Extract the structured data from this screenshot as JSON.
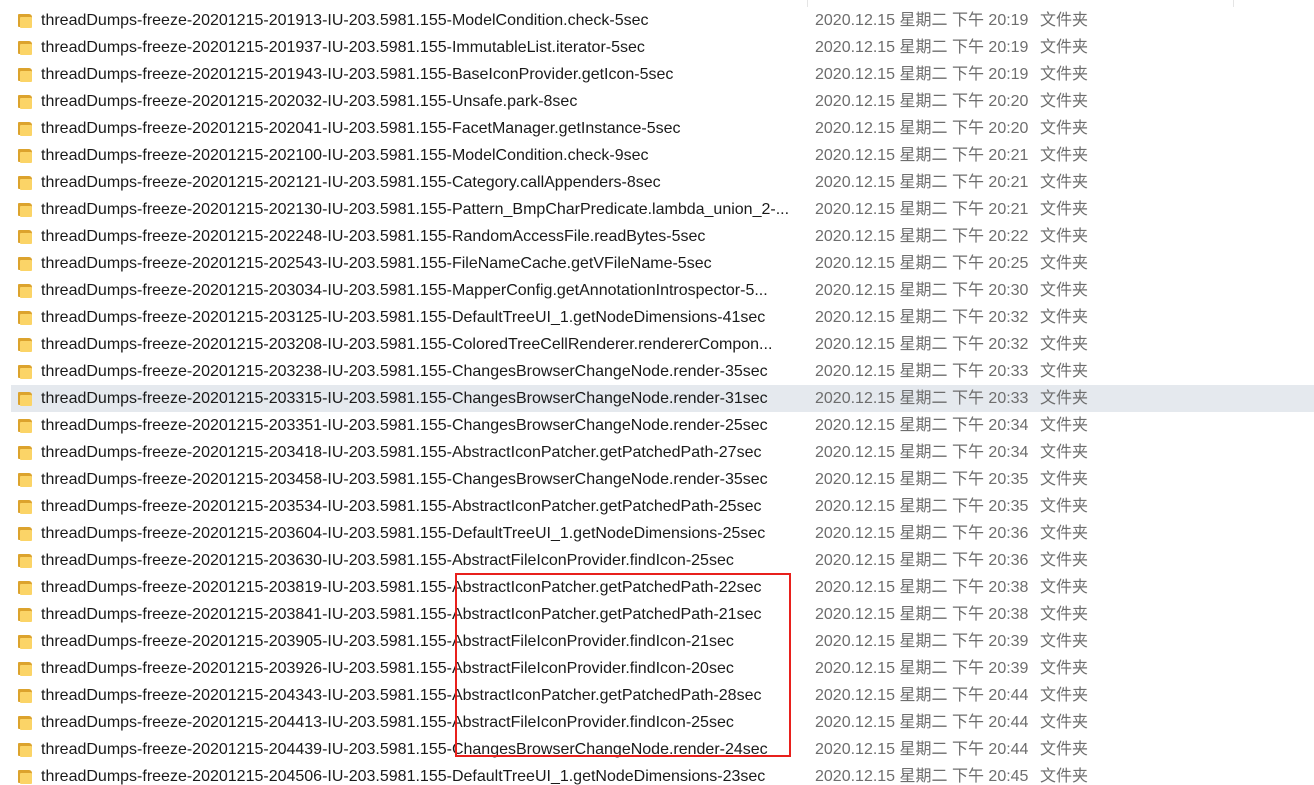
{
  "file_list": {
    "icon": "folder-icon",
    "highlight_color": "#e5e9ee",
    "annotation_color": "#e8201c",
    "rows": [
      {
        "name": "threadDumps-freeze-20201215-201913-IU-203.5981.155-ModelCondition.check-5sec",
        "date": "2020.12.15 星期二 下午 20:19",
        "type": "文件夹"
      },
      {
        "name": "threadDumps-freeze-20201215-201937-IU-203.5981.155-ImmutableList.iterator-5sec",
        "date": "2020.12.15 星期二 下午 20:19",
        "type": "文件夹"
      },
      {
        "name": "threadDumps-freeze-20201215-201943-IU-203.5981.155-BaseIconProvider.getIcon-5sec",
        "date": "2020.12.15 星期二 下午 20:19",
        "type": "文件夹"
      },
      {
        "name": "threadDumps-freeze-20201215-202032-IU-203.5981.155-Unsafe.park-8sec",
        "date": "2020.12.15 星期二 下午 20:20",
        "type": "文件夹"
      },
      {
        "name": "threadDumps-freeze-20201215-202041-IU-203.5981.155-FacetManager.getInstance-5sec",
        "date": "2020.12.15 星期二 下午 20:20",
        "type": "文件夹"
      },
      {
        "name": "threadDumps-freeze-20201215-202100-IU-203.5981.155-ModelCondition.check-9sec",
        "date": "2020.12.15 星期二 下午 20:21",
        "type": "文件夹"
      },
      {
        "name": "threadDumps-freeze-20201215-202121-IU-203.5981.155-Category.callAppenders-8sec",
        "date": "2020.12.15 星期二 下午 20:21",
        "type": "文件夹"
      },
      {
        "name": "threadDumps-freeze-20201215-202130-IU-203.5981.155-Pattern_BmpCharPredicate.lambda_union_2-...",
        "date": "2020.12.15 星期二 下午 20:21",
        "type": "文件夹"
      },
      {
        "name": "threadDumps-freeze-20201215-202248-IU-203.5981.155-RandomAccessFile.readBytes-5sec",
        "date": "2020.12.15 星期二 下午 20:22",
        "type": "文件夹"
      },
      {
        "name": "threadDumps-freeze-20201215-202543-IU-203.5981.155-FileNameCache.getVFileName-5sec",
        "date": "2020.12.15 星期二 下午 20:25",
        "type": "文件夹"
      },
      {
        "name": "threadDumps-freeze-20201215-203034-IU-203.5981.155-MapperConfig.getAnnotationIntrospector-5...",
        "date": "2020.12.15 星期二 下午 20:30",
        "type": "文件夹"
      },
      {
        "name": "threadDumps-freeze-20201215-203125-IU-203.5981.155-DefaultTreeUI_1.getNodeDimensions-41sec",
        "date": "2020.12.15 星期二 下午 20:32",
        "type": "文件夹"
      },
      {
        "name": "threadDumps-freeze-20201215-203208-IU-203.5981.155-ColoredTreeCellRenderer.rendererCompon...",
        "date": "2020.12.15 星期二 下午 20:32",
        "type": "文件夹"
      },
      {
        "name": "threadDumps-freeze-20201215-203238-IU-203.5981.155-ChangesBrowserChangeNode.render-35sec",
        "date": "2020.12.15 星期二 下午 20:33",
        "type": "文件夹"
      },
      {
        "name": "threadDumps-freeze-20201215-203315-IU-203.5981.155-ChangesBrowserChangeNode.render-31sec",
        "date": "2020.12.15 星期二 下午 20:33",
        "type": "文件夹",
        "hovered": true
      },
      {
        "name": "threadDumps-freeze-20201215-203351-IU-203.5981.155-ChangesBrowserChangeNode.render-25sec",
        "date": "2020.12.15 星期二 下午 20:34",
        "type": "文件夹"
      },
      {
        "name": "threadDumps-freeze-20201215-203418-IU-203.5981.155-AbstractIconPatcher.getPatchedPath-27sec",
        "date": "2020.12.15 星期二 下午 20:34",
        "type": "文件夹"
      },
      {
        "name": "threadDumps-freeze-20201215-203458-IU-203.5981.155-ChangesBrowserChangeNode.render-35sec",
        "date": "2020.12.15 星期二 下午 20:35",
        "type": "文件夹"
      },
      {
        "name": "threadDumps-freeze-20201215-203534-IU-203.5981.155-AbstractIconPatcher.getPatchedPath-25sec",
        "date": "2020.12.15 星期二 下午 20:35",
        "type": "文件夹"
      },
      {
        "name": "threadDumps-freeze-20201215-203604-IU-203.5981.155-DefaultTreeUI_1.getNodeDimensions-25sec",
        "date": "2020.12.15 星期二 下午 20:36",
        "type": "文件夹"
      },
      {
        "name": "threadDumps-freeze-20201215-203630-IU-203.5981.155-AbstractFileIconProvider.findIcon-25sec",
        "date": "2020.12.15 星期二 下午 20:36",
        "type": "文件夹"
      },
      {
        "name": "threadDumps-freeze-20201215-203819-IU-203.5981.155-AbstractIconPatcher.getPatchedPath-22sec",
        "date": "2020.12.15 星期二 下午 20:38",
        "type": "文件夹"
      },
      {
        "name": "threadDumps-freeze-20201215-203841-IU-203.5981.155-AbstractIconPatcher.getPatchedPath-21sec",
        "date": "2020.12.15 星期二 下午 20:38",
        "type": "文件夹"
      },
      {
        "name": "threadDumps-freeze-20201215-203905-IU-203.5981.155-AbstractFileIconProvider.findIcon-21sec",
        "date": "2020.12.15 星期二 下午 20:39",
        "type": "文件夹"
      },
      {
        "name": "threadDumps-freeze-20201215-203926-IU-203.5981.155-AbstractFileIconProvider.findIcon-20sec",
        "date": "2020.12.15 星期二 下午 20:39",
        "type": "文件夹"
      },
      {
        "name": "threadDumps-freeze-20201215-204343-IU-203.5981.155-AbstractIconPatcher.getPatchedPath-28sec",
        "date": "2020.12.15 星期二 下午 20:44",
        "type": "文件夹"
      },
      {
        "name": "threadDumps-freeze-20201215-204413-IU-203.5981.155-AbstractFileIconProvider.findIcon-25sec",
        "date": "2020.12.15 星期二 下午 20:44",
        "type": "文件夹"
      },
      {
        "name": "threadDumps-freeze-20201215-204439-IU-203.5981.155-ChangesBrowserChangeNode.render-24sec",
        "date": "2020.12.15 星期二 下午 20:44",
        "type": "文件夹"
      },
      {
        "name": "threadDumps-freeze-20201215-204506-IU-203.5981.155-DefaultTreeUI_1.getNodeDimensions-23sec",
        "date": "2020.12.15 星期二 下午 20:45",
        "type": "文件夹"
      }
    ]
  }
}
